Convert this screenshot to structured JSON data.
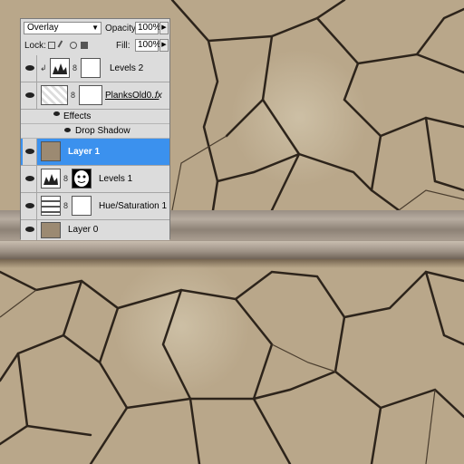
{
  "panel": {
    "blend_mode": "Overlay",
    "opacity_label": "Opacity:",
    "opacity_value": "100%",
    "lock_label": "Lock:",
    "fill_label": "Fill:",
    "fill_value": "100%"
  },
  "layers": [
    {
      "name": "Levels 2",
      "type": "adjustment",
      "clipped": true
    },
    {
      "name": "PlanksOld0...",
      "type": "image",
      "fx": "fx"
    },
    {
      "name": "Effects",
      "type": "effects-header"
    },
    {
      "name": "Drop Shadow",
      "type": "effect"
    },
    {
      "name": "Layer 1",
      "type": "image",
      "selected": true
    },
    {
      "name": "Levels 1",
      "type": "adjustment"
    },
    {
      "name": "Hue/Saturation 1",
      "type": "adjustment"
    },
    {
      "name": "Layer 0",
      "type": "image"
    }
  ],
  "colors": {
    "selection": "#3b91ee",
    "panel_bg": "#d6d6d6"
  }
}
